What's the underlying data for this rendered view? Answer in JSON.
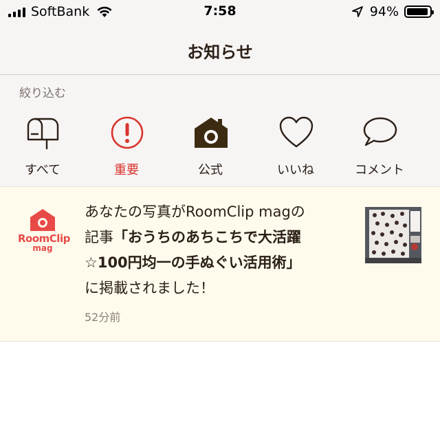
{
  "status_bar": {
    "carrier": "SoftBank",
    "time": "7:58",
    "battery_percent": "94%",
    "battery_level": 0.94
  },
  "header": {
    "title": "お知らせ"
  },
  "filter": {
    "label": "絞り込む",
    "items": [
      {
        "label": "すべて",
        "icon": "mailbox-icon"
      },
      {
        "label": "重要",
        "icon": "exclamation-circle-icon",
        "color": "#d9352e"
      },
      {
        "label": "公式",
        "icon": "house-camera-icon"
      },
      {
        "label": "いいね",
        "icon": "heart-icon"
      },
      {
        "label": "コメント",
        "icon": "speech-bubble-icon"
      }
    ]
  },
  "notification": {
    "logo_text": "RoomClip",
    "logo_sub": "mag",
    "text_line1": "あなたの写真がRoomClip magの",
    "text_line2_prefix": "記事",
    "text_bold_1": "「おうちのあちこちで大活躍",
    "text_bold_2": "☆100円均一の手ぬぐい活用術」",
    "text_line4": "に掲載されました！",
    "time": "52分前"
  },
  "colors": {
    "accent_red": "#d9352e",
    "logo_red": "#e84a47",
    "notification_bg": "#fefbed",
    "bar_bg": "#f7f4f4"
  }
}
